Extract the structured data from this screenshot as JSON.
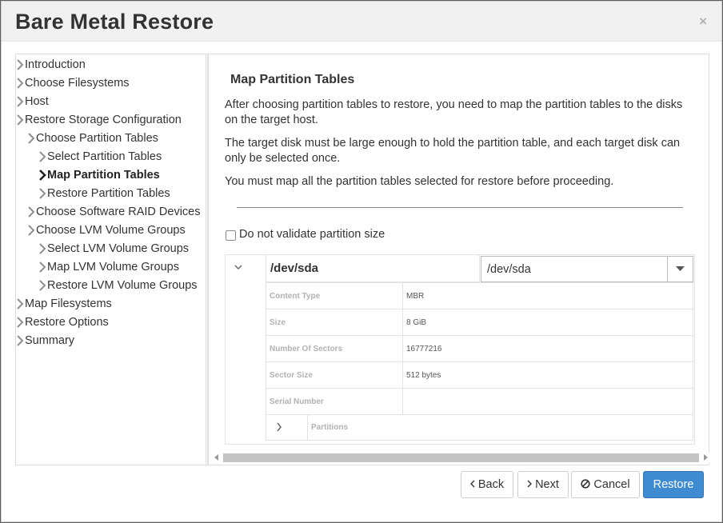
{
  "dialog": {
    "title": "Bare Metal Restore",
    "close_glyph": "×"
  },
  "nav": {
    "items": [
      {
        "label": "Introduction"
      },
      {
        "label": "Choose Filesystems"
      },
      {
        "label": "Host"
      },
      {
        "label": "Restore Storage Configuration"
      },
      {
        "label": "Choose Partition Tables"
      },
      {
        "label": "Select Partition Tables"
      },
      {
        "label": "Map Partition Tables"
      },
      {
        "label": "Restore Partition Tables"
      },
      {
        "label": "Choose Software RAID Devices"
      },
      {
        "label": "Choose LVM Volume Groups"
      },
      {
        "label": "Select LVM Volume Groups"
      },
      {
        "label": "Map LVM Volume Groups"
      },
      {
        "label": "Restore LVM Volume Groups"
      },
      {
        "label": "Map Filesystems"
      },
      {
        "label": "Restore Options"
      },
      {
        "label": "Summary"
      }
    ],
    "active": "Map Partition Tables"
  },
  "content": {
    "heading": "Map Partition Tables",
    "paragraphs": [
      "After choosing partition tables to restore, you need to map the partition tables to the disks on the target host.",
      "The target disk must be large enough to hold the partition table, and each target disk can only be selected once.",
      "You must map all the partition tables selected for restore before proceeding."
    ],
    "validate_checkbox": {
      "label": "Do not validate partition size",
      "checked": false
    },
    "disk": {
      "name": "/dev/sda",
      "target": "/dev/sda",
      "properties": [
        {
          "key": "Content Type",
          "value": "MBR"
        },
        {
          "key": "Size",
          "value": "8 GiB"
        },
        {
          "key": "Number Of Sectors",
          "value": "16777216"
        },
        {
          "key": "Sector Size",
          "value": "512 bytes"
        },
        {
          "key": "Serial Number",
          "value": ""
        }
      ],
      "partitions_label": "Partitions"
    }
  },
  "footer": {
    "back": "Back",
    "next": "Next",
    "cancel": "Cancel",
    "restore": "Restore"
  },
  "icons": {
    "nav_chevron": "chevron-right-icon",
    "disk_expander": "chevron-down-icon",
    "select_caret": "caret-down-icon",
    "cancel_icon": "ban-icon"
  },
  "colors": {
    "primary": "#3e8bd2",
    "header_bg": "#f1f1f1",
    "muted_label": "#b2b2b2"
  }
}
